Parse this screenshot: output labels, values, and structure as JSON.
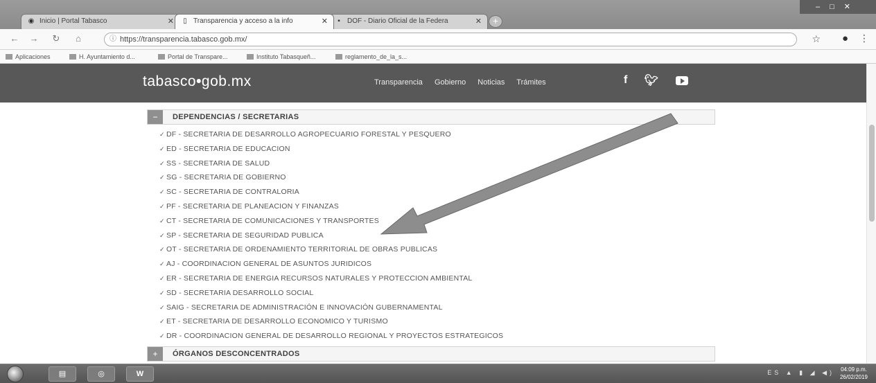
{
  "browser": {
    "tabs": [
      {
        "title": "Inicio | Portal Tabasco",
        "active": false
      },
      {
        "title": "Transparencia y acceso a la info",
        "active": true
      },
      {
        "title": "DOF - Diario Oficial de la Federa",
        "active": false
      }
    ],
    "url": "https://transparencia.tabasco.gob.mx/",
    "bookmarks": [
      "Aplicaciones",
      "H. Ayuntamiento d...",
      "Portal de Transpare...",
      "Instituto Tabasqueñ...",
      "reglamento_de_la_s..."
    ]
  },
  "site": {
    "logo_text": "tabasco",
    "logo_dot": "•",
    "logo_suffix": "gob.mx",
    "nav": [
      "Transparencia",
      "Gobierno",
      "Noticias",
      "Trámites"
    ],
    "social_icons": [
      "facebook-icon",
      "twitter-icon",
      "youtube-icon"
    ],
    "sections": [
      {
        "toggle": "−",
        "title": "DEPENDENCIAS / SECRETARIAS"
      },
      {
        "toggle": "+",
        "title": "ÓRGANOS DESCONCENTRADOS"
      }
    ],
    "dependencias": [
      "DF - SECRETARIA DE DESARROLLO AGROPECUARIO FORESTAL Y PESQUERO",
      "ED - SECRETARIA DE EDUCACION",
      "SS - SECRETARIA DE SALUD",
      "SG - SECRETARIA DE GOBIERNO",
      "SC - SECRETARIA DE CONTRALORIA",
      "PF - SECRETARIA DE PLANEACION Y FINANZAS",
      "CT - SECRETARIA DE COMUNICACIONES Y TRANSPORTES",
      "SP - SECRETARIA DE SEGURIDAD PUBLICA",
      "OT - SECRETARIA DE ORDENAMIENTO TERRITORIAL DE OBRAS PUBLICAS",
      "AJ - COORDINACION GENERAL DE ASUNTOS JURIDICOS",
      "ER - SECRETARIA DE ENERGIA RECURSOS NATURALES Y PROTECCION AMBIENTAL",
      "SD - SECRETARIA DESARROLLO SOCIAL",
      "SAIG - SECRETARIA DE ADMINISTRACIÓN E INNOVACIÓN GUBERNAMENTAL",
      "ET - SECRETARIA DE DESARROLLO ECONOMICO Y TURISMO",
      "DR - COORDINACION GENERAL DE DESARROLLO REGIONAL Y PROYECTOS ESTRATEGICOS"
    ],
    "check_glyph": "✓"
  },
  "taskbar": {
    "word_label": "W",
    "tray_text": "ES ▲ ▮ ◢ ◀)",
    "clock_time": "04:09 p.m.",
    "clock_date": "26/02/2019"
  }
}
